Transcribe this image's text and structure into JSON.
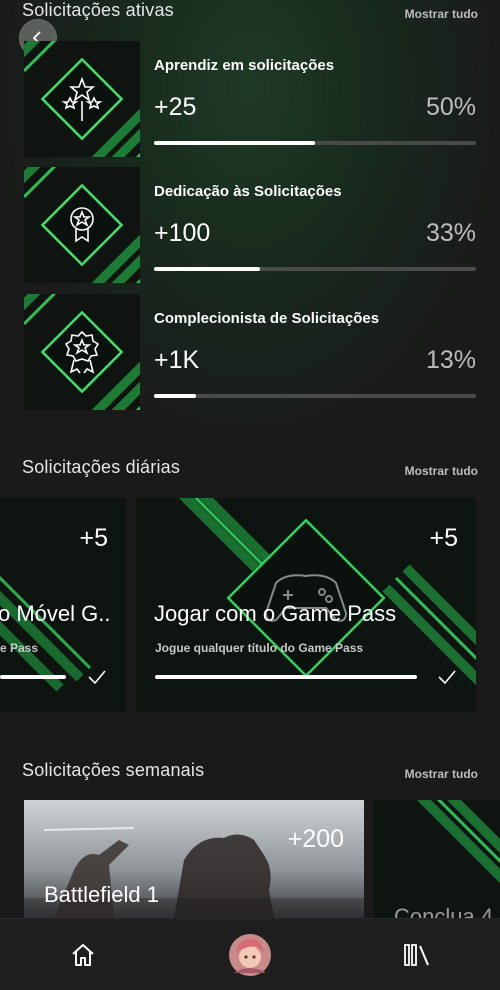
{
  "active": {
    "title": "Solicitações ativas",
    "see_all": "Mostrar tudo",
    "items": [
      {
        "name": "Aprendiz em solicitações",
        "points": "+25",
        "percent": "50%",
        "progress": 0.5,
        "icon": "wand-icon"
      },
      {
        "name": "Dedicação às Solicitações",
        "points": "+100",
        "percent": "33%",
        "progress": 0.33,
        "icon": "medal-icon"
      },
      {
        "name": "Complecionista de Solicitações",
        "points": "+1K",
        "percent": "13%",
        "progress": 0.13,
        "icon": "rosette-icon"
      }
    ]
  },
  "daily": {
    "title": "Solicitações diárias",
    "see_all": "Mostrar tudo",
    "cards": [
      {
        "title_visible": "o Móvel G..",
        "subtitle_visible": "e Pass",
        "points": "+5",
        "progress": 1.0
      },
      {
        "title": "Jogar com o Game Pass",
        "subtitle": "Jogue qualquer título do Game Pass",
        "points": "+5",
        "progress": 1.0,
        "icon": "controller-icon"
      }
    ]
  },
  "weekly": {
    "title": "Solicitações semanais",
    "see_all": "Mostrar tudo",
    "cards": [
      {
        "title": "Battlefield 1",
        "points": "+200"
      },
      {
        "title_visible": "Conclua 4"
      }
    ]
  },
  "nav": {
    "home_icon": "home-icon",
    "avatar": "avatar",
    "library_icon": "library-icon"
  },
  "colors": {
    "accent": "#2ecc5a",
    "background": "#1a1a1a"
  }
}
